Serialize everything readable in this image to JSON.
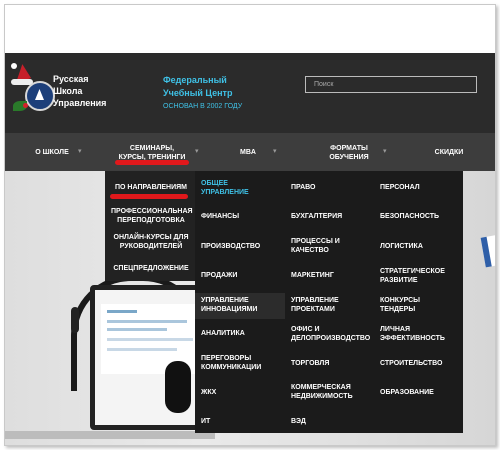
{
  "brand": {
    "line1": "Русская",
    "line2": "Школа",
    "line3": "Управления"
  },
  "center": {
    "line1": "Федеральный",
    "line2": "Учебный Центр",
    "line3": "ОСНОВАН В 2002 ГОДУ"
  },
  "search": {
    "placeholder": "Поиск"
  },
  "nav": [
    {
      "label": "О ШКОЛЕ"
    },
    {
      "label1": "СЕМИНАРЫ,",
      "label2": "КУРСЫ, ТРЕНИНГИ"
    },
    {
      "label": "MBA"
    },
    {
      "label1": "ФОРМАТЫ",
      "label2": "ОБУЧЕНИЯ"
    },
    {
      "label": "СКИДКИ"
    }
  ],
  "left_menu": [
    {
      "l1": "ПО НАПРАВЛЕНИЯМ"
    },
    {
      "l1": "ПРОФЕССИОНАЛЬНАЯ",
      "l2": "ПЕРЕПОДГОТОВКА"
    },
    {
      "l1": "ОНЛАЙН-КУРСЫ ДЛЯ",
      "l2": "РУКОВОДИТЕЛЕЙ"
    },
    {
      "l1": "СПЕЦПРЕДЛОЖЕНИЕ"
    }
  ],
  "col1": [
    {
      "l1": "ОБЩЕЕ",
      "l2": "УПРАВЛЕНИЕ"
    },
    {
      "l1": "ФИНАНСЫ"
    },
    {
      "l1": "ПРОИЗВОДСТВО"
    },
    {
      "l1": "ПРОДАЖИ"
    },
    {
      "l1": "УПРАВЛЕНИЕ",
      "l2": "ИННОВАЦИЯМИ"
    },
    {
      "l1": "АНАЛИТИКА"
    },
    {
      "l1": "ПЕРЕГОВОРЫ",
      "l2": "КОММУНИКАЦИИ"
    },
    {
      "l1": "ЖКХ"
    },
    {
      "l1": "ИТ"
    }
  ],
  "col2": [
    {
      "l1": "ПРАВО"
    },
    {
      "l1": "БУХГАЛТЕРИЯ"
    },
    {
      "l1": "ПРОЦЕССЫ И",
      "l2": "КАЧЕСТВО"
    },
    {
      "l1": "МАРКЕТИНГ"
    },
    {
      "l1": "УПРАВЛЕНИЕ",
      "l2": "ПРОЕКТАМИ"
    },
    {
      "l1": "ОФИС И",
      "l2": "ДЕЛОПРОИЗВОДСТВО"
    },
    {
      "l1": "ТОРГОВЛЯ"
    },
    {
      "l1": "КОММЕРЧЕСКАЯ",
      "l2": "НЕДВИЖИМОСТЬ"
    },
    {
      "l1": "ВЭД"
    }
  ],
  "col3": [
    {
      "l1": "ПЕРСОНАЛ"
    },
    {
      "l1": "БЕЗОПАСНОСТЬ"
    },
    {
      "l1": "ЛОГИСТИКА"
    },
    {
      "l1": "СТРАТЕГИЧЕСКОЕ",
      "l2": "РАЗВИТИЕ"
    },
    {
      "l1": "КОНКУРСЫ",
      "l2": "ТЕНДЕРЫ"
    },
    {
      "l1": "ЛИЧНАЯ",
      "l2": "ЭФФЕКТИВНОСТЬ"
    },
    {
      "l1": "СТРОИТЕЛЬСТВО"
    },
    {
      "l1": "ОБРАЗОВАНИЕ"
    }
  ],
  "colors": {
    "accent": "#3fc1e6",
    "highlight": "#e0181b",
    "header_bg": "#2b2b2b",
    "menu_bg": "#1b1b1b"
  }
}
